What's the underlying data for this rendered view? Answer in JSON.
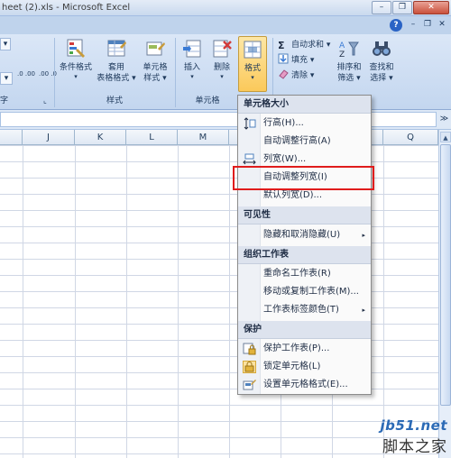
{
  "window": {
    "title": "heet (2).xls - Microsoft Excel",
    "minimize": "–",
    "restore": "❐",
    "close": "✕"
  },
  "ribbon_controls": {
    "help": "?",
    "minimize": "–",
    "restore": "❐",
    "close": "✕"
  },
  "ribbon": {
    "font_combo": "▾",
    "number": {
      "dec_inc": ".0 .00",
      "dec_dec": ".00 .0",
      "group_label": "字",
      "launcher": "⌞"
    },
    "styles": {
      "conditional_format": "条件格式",
      "table_format_1": "套用",
      "table_format_2": "表格格式",
      "cell_style_1": "单元格",
      "cell_style_2": "样式",
      "group_label": "样式"
    },
    "cells": {
      "insert": "插入",
      "delete": "删除",
      "format": "格式",
      "group_label": "单元格"
    },
    "editing": {
      "autosum": "自动求和",
      "fill": "填充",
      "clear": "清除",
      "sort_filter_1": "排序和",
      "sort_filter_2": "筛选",
      "find_select_1": "查找和",
      "find_select_2": "选择"
    }
  },
  "formula_bar": {
    "expand": "≫"
  },
  "columns": [
    "J",
    "K",
    "L",
    "M",
    "Q"
  ],
  "format_menu": {
    "sec_cell_size": "单元格大小",
    "row_height": "行高(H)...",
    "autofit_row": "自动调整行高(A)",
    "col_width": "列宽(W)...",
    "autofit_col": "自动调整列宽(I)",
    "default_width": "默认列宽(D)...",
    "sec_visibility": "可见性",
    "hide_unhide": "隐藏和取消隐藏(U)",
    "sec_organize": "组织工作表",
    "rename_sheet": "重命名工作表(R)",
    "move_copy": "移动或复制工作表(M)...",
    "tab_color": "工作表标签颜色(T)",
    "sec_protect": "保护",
    "protect_sheet": "保护工作表(P)...",
    "lock_cell": "锁定单元格(L)",
    "format_cells": "设置单元格格式(E)...",
    "submenu_arrow": "▸"
  },
  "watermark": {
    "site": "jb51.net",
    "name": "脚本之家"
  },
  "colors": {
    "accent": "#fbc95a",
    "highlight": "#e01c1c"
  }
}
